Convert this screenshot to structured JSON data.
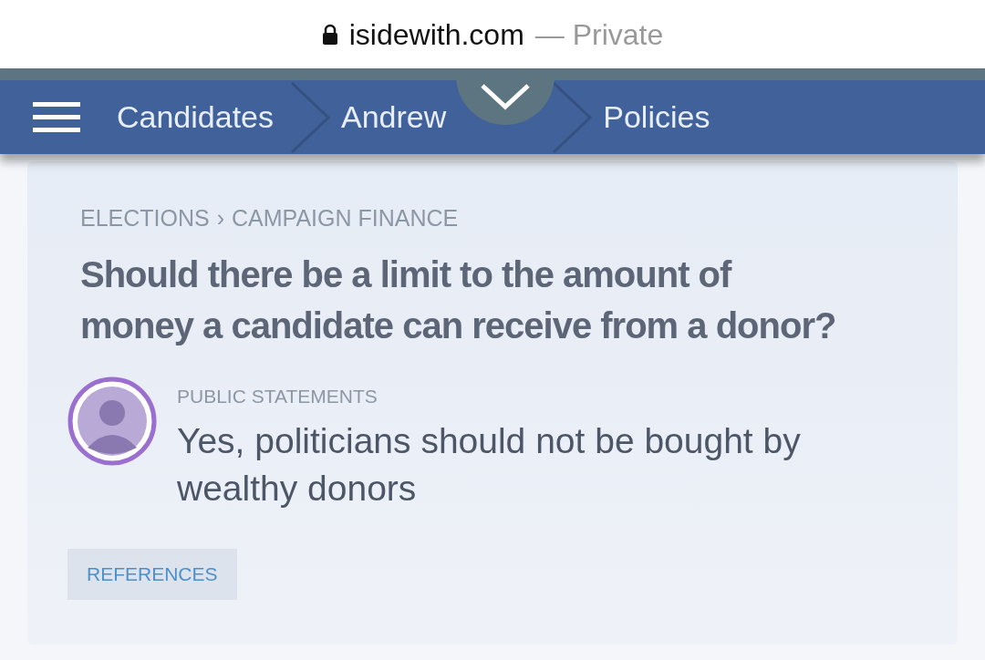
{
  "address_bar": {
    "domain": "isidewith.com",
    "mode": "— Private"
  },
  "nav": {
    "breadcrumbs": [
      {
        "label": "Candidates"
      },
      {
        "label": "Andrew"
      },
      {
        "label": "Policies"
      }
    ]
  },
  "question": {
    "category_path": [
      "ELECTIONS",
      "CAMPAIGN FINANCE"
    ],
    "separator": "›",
    "title": "Should there be a limit to the amount of money a candidate can receive from a donor?"
  },
  "statement": {
    "label": "PUBLIC STATEMENTS",
    "text": "Yes, politicians should not be bought by wealthy donors"
  },
  "references_button": "REFERENCES"
}
